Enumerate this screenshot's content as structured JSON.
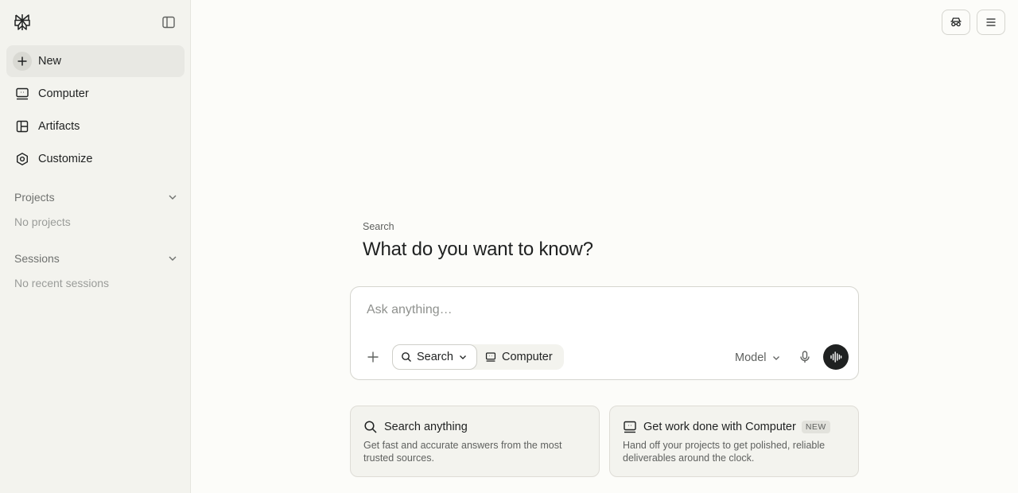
{
  "sidebar": {
    "logo_icon": "perplexity-logo-icon",
    "collapse_icon": "sidebar-toggle-icon",
    "nav": [
      {
        "label": "New",
        "icon": "plus-icon"
      },
      {
        "label": "Computer",
        "icon": "computer-icon"
      },
      {
        "label": "Artifacts",
        "icon": "artifacts-icon"
      },
      {
        "label": "Customize",
        "icon": "hexagon-icon"
      }
    ],
    "projects": {
      "title": "Projects",
      "empty": "No projects"
    },
    "sessions": {
      "title": "Sessions",
      "empty": "No recent sessions"
    }
  },
  "header": {
    "incognito_icon": "incognito-icon",
    "menu_icon": "menu-icon"
  },
  "main": {
    "mode_label": "Search",
    "heading": "What do you want to know?",
    "composer": {
      "placeholder": "Ask anything…",
      "search_label": "Search",
      "computer_label": "Computer",
      "model_label": "Model"
    },
    "cards": [
      {
        "title": "Search anything",
        "desc": "Get fast and accurate answers from the most trusted sources.",
        "icon": "search-icon"
      },
      {
        "title": "Get work done with Computer",
        "badge": "NEW",
        "desc": "Hand off your projects to get polished, reliable deliverables around the clock.",
        "icon": "computer-icon"
      }
    ]
  },
  "colors": {
    "background": "#fcfcf9",
    "sidebar": "#f3f3ee",
    "text": "#1f2121",
    "muted": "#6f716f",
    "voice_button": "#1f2121"
  }
}
